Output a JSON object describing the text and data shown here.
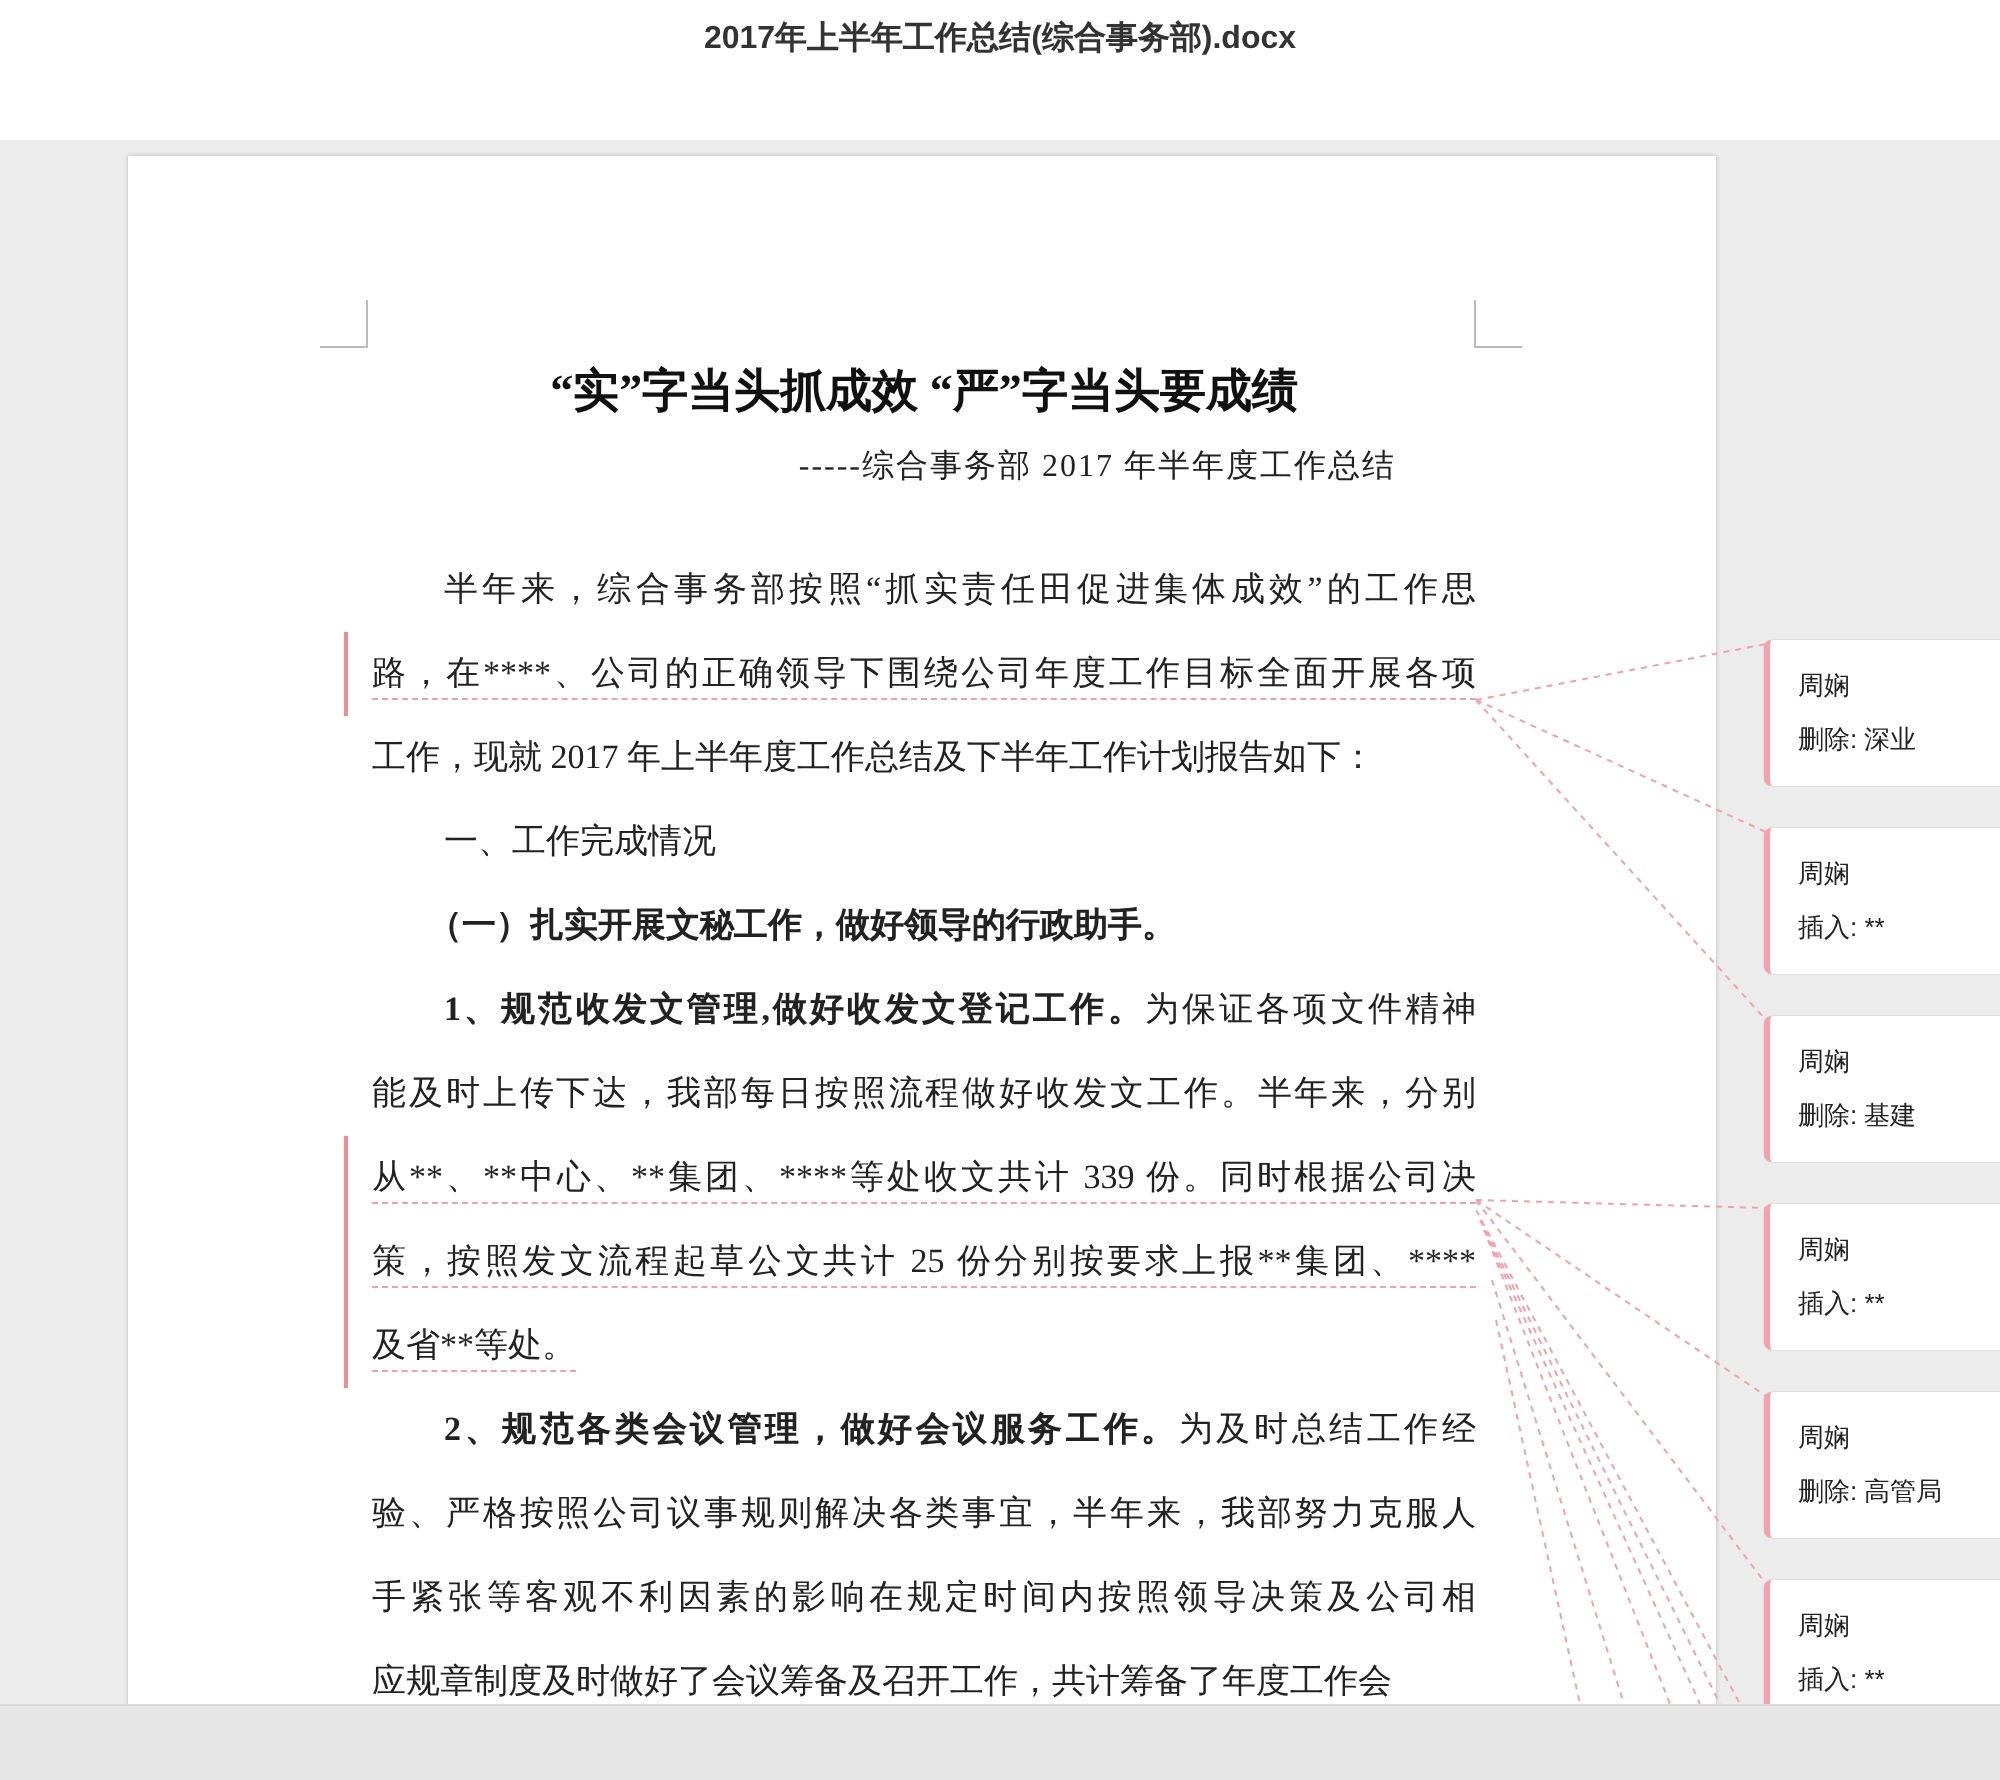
{
  "window": {
    "title": "2017年上半年工作总结(综合事务部).docx"
  },
  "document": {
    "title": "“实”字当头抓成效 “严”字当头要成绩",
    "subtitle": "-----综合事务部 2017 年半年度工作总结",
    "paragraphs": [
      {
        "kind": "body",
        "lines": [
          {
            "text": "半年来，综合事务部按照“抓实责任田促进集体成效”的工作思",
            "change_bar": false
          },
          {
            "text": "路，在****、公司的正确领导下围绕公司年度工作目标全面开展各项",
            "change_bar": true
          },
          {
            "text": "工作，现就 2017 年上半年度工作总结及下半年工作计划报告如下：",
            "change_bar": false
          }
        ]
      },
      {
        "kind": "heading",
        "lines": [
          {
            "text": "一、工作完成情况",
            "change_bar": false
          }
        ]
      },
      {
        "kind": "subheading",
        "lines": [
          {
            "text": "（一）扎实开展文秘工作，做好领导的行政助手。",
            "change_bar": false
          }
        ]
      },
      {
        "kind": "body",
        "lines": [
          {
            "bold": "1、规范收发文管理,做好收发文登记工作。",
            "text": "为保证各项文件精神",
            "change_bar": false
          },
          {
            "text": "能及时上传下达，我部每日按照流程做好收发文工作。半年来，分别",
            "change_bar": false
          },
          {
            "text": "从**、**中心、**集团、****等处收文共计 339 份。同时根据公司决",
            "change_bar": true
          },
          {
            "text": "策，按照发文流程起草公文共计 25 份分别按要求上报**集团、****",
            "change_bar": true
          },
          {
            "text": "及省**等处。",
            "change_bar": true
          }
        ]
      },
      {
        "kind": "body",
        "lines": [
          {
            "bold": "2、规范各类会议管理，做好会议服务工作。",
            "text": "为及时总结工作经",
            "change_bar": false
          },
          {
            "text": "验、严格按照公司议事规则解决各类事宜，半年来，我部努力克服人",
            "change_bar": false
          },
          {
            "text": "手紧张等客观不利因素的影响在规定时间内按照领导决策及公司相",
            "change_bar": false
          },
          {
            "text": "应规章制度及时做好了会议筹备及召开工作，共计筹备了年度工作会",
            "change_bar": false
          }
        ]
      }
    ]
  },
  "comments": [
    {
      "author": "周娴",
      "change": "删除: 深业"
    },
    {
      "author": "周娴",
      "change": "插入: **"
    },
    {
      "author": "周娴",
      "change": "删除: 基建"
    },
    {
      "author": "周娴",
      "change": "插入: **"
    },
    {
      "author": "周娴",
      "change": "删除: 高管局"
    },
    {
      "author": "周娴",
      "change": "插入: **"
    }
  ]
}
